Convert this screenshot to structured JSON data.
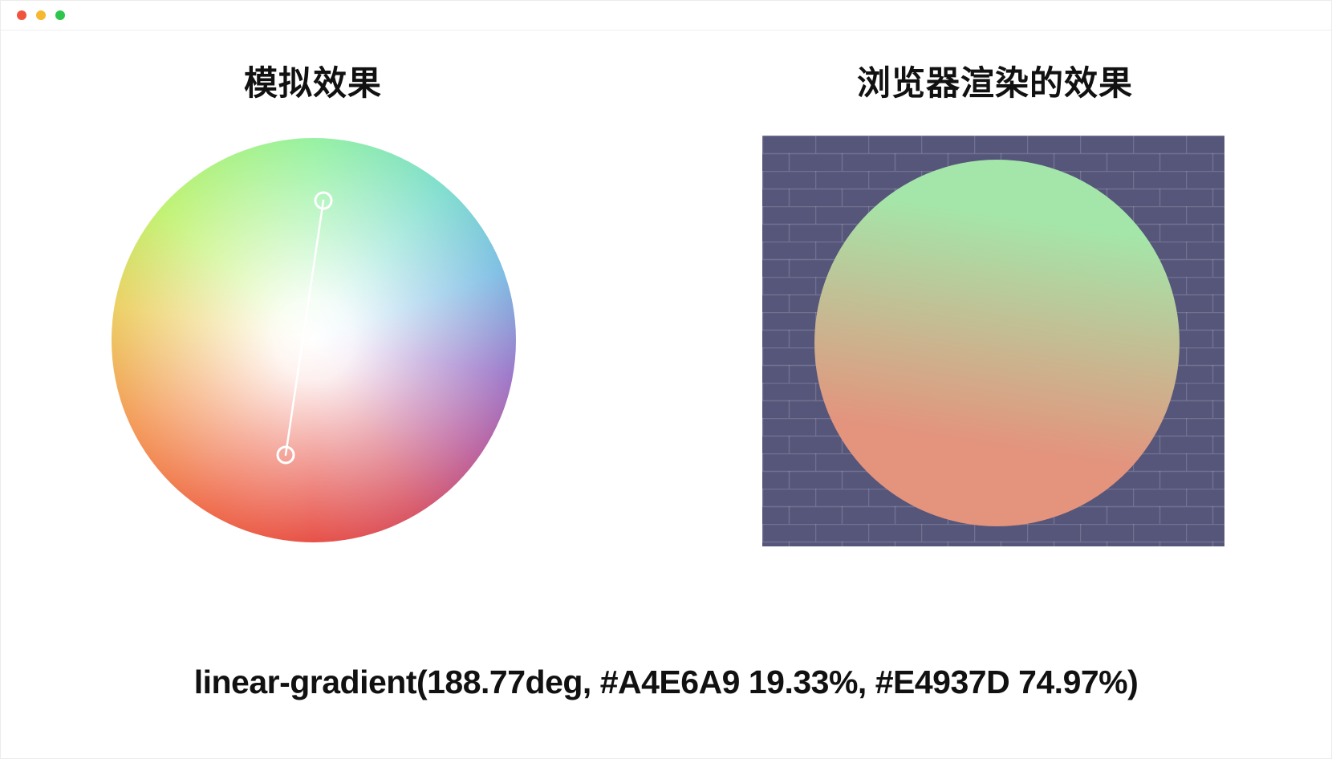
{
  "window": {
    "traffic_lights": {
      "close_color": "#f0543f",
      "minimize_color": "#f5b82e",
      "zoom_color": "#2bc64a"
    }
  },
  "left_panel": {
    "title": "模拟效果",
    "picker": {
      "handles": [
        "start-handle",
        "end-handle"
      ]
    }
  },
  "right_panel": {
    "title": "浏览器渲染的效果",
    "background_color": "#55567a",
    "gradient": {
      "angle": "188.77deg",
      "stop1_color": "#A4E6A9",
      "stop1_position": "19.33%",
      "stop2_color": "#E4937D",
      "stop2_position": "74.97%"
    }
  },
  "code_text": "linear-gradient(188.77deg, #A4E6A9 19.33%, #E4937D 74.97%)"
}
